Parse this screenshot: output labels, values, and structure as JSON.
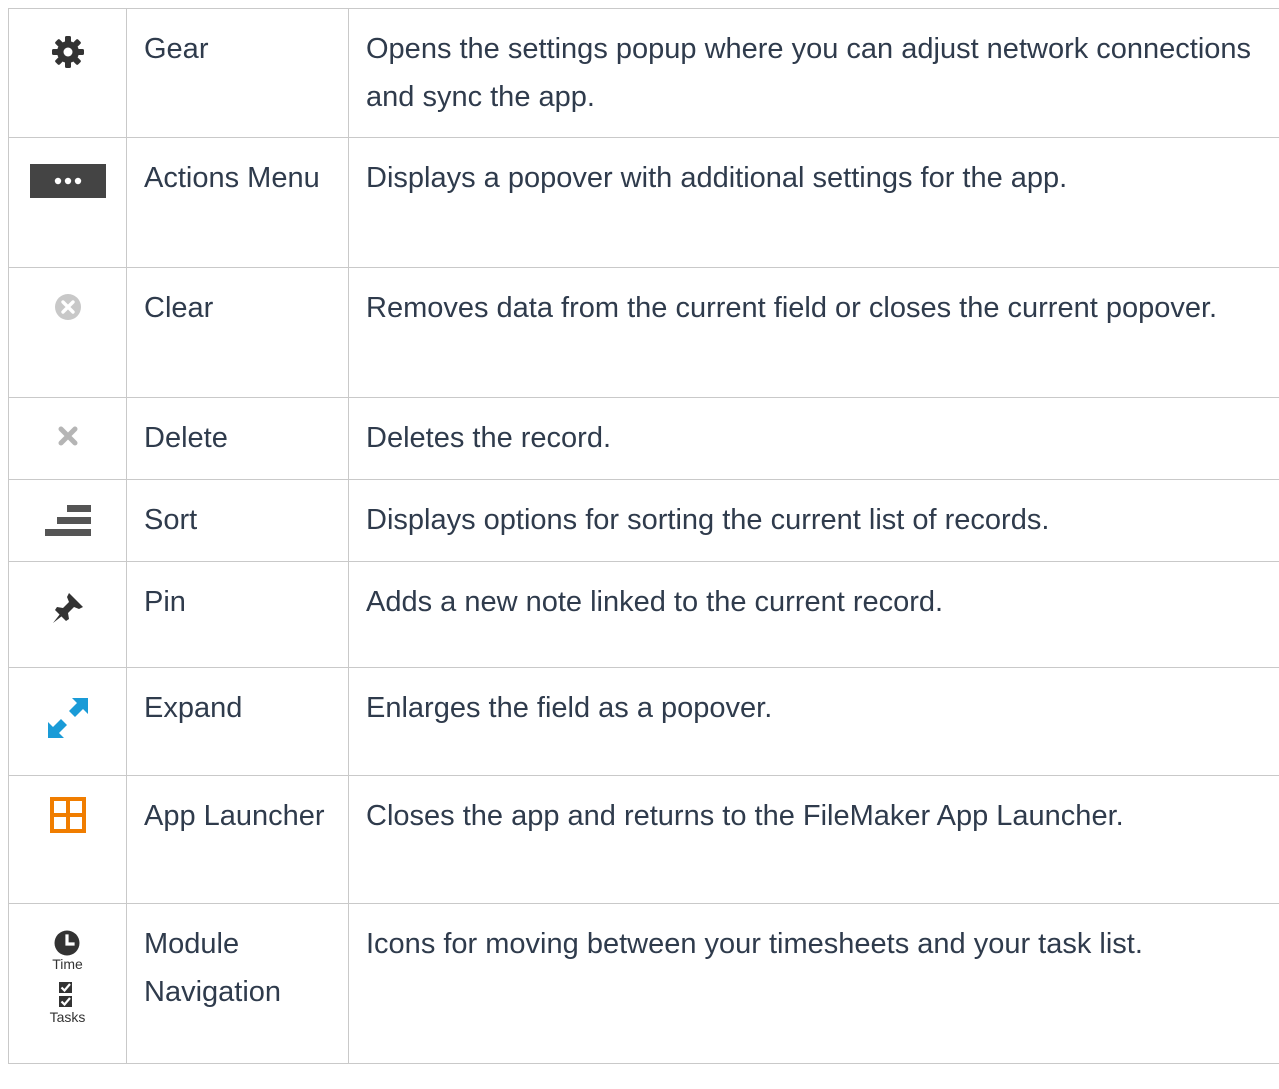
{
  "rows": [
    {
      "icon": "gear-icon",
      "name": "Gear",
      "description": "Opens the settings popup where you can adjust network connections and sync the app."
    },
    {
      "icon": "actions-menu-icon",
      "name": "Actions Menu",
      "description": "Displays a popover with additional settings for the app."
    },
    {
      "icon": "clear-icon",
      "name": "Clear",
      "description": "Removes data from the current field or closes the current popover."
    },
    {
      "icon": "delete-icon",
      "name": "Delete",
      "description": "Deletes the record."
    },
    {
      "icon": "sort-icon",
      "name": "Sort",
      "description": "Displays options for sorting the current list of records."
    },
    {
      "icon": "pin-icon",
      "name": "Pin",
      "description": "Adds a new note linked to the current record."
    },
    {
      "icon": "expand-icon",
      "name": "Expand",
      "description": "Enlarges the field as a popover."
    },
    {
      "icon": "app-launcher-icon",
      "name": "App Launcher",
      "description": "Closes the app and returns to the FileMaker App Launcher."
    },
    {
      "icon": "module-navigation-icon",
      "name": "Module Navigation",
      "description": "Icons for moving between  your timesheets and your task list."
    }
  ],
  "module_navigation": {
    "time_label": "Time",
    "tasks_label": "Tasks"
  },
  "colors": {
    "text": "#2f3b4c",
    "border": "#c9c9c9",
    "icon_dark": "#444444",
    "icon_light_gray": "#c8c8c8",
    "expand_blue": "#1a9bd7",
    "launcher_orange": "#f07d00"
  }
}
